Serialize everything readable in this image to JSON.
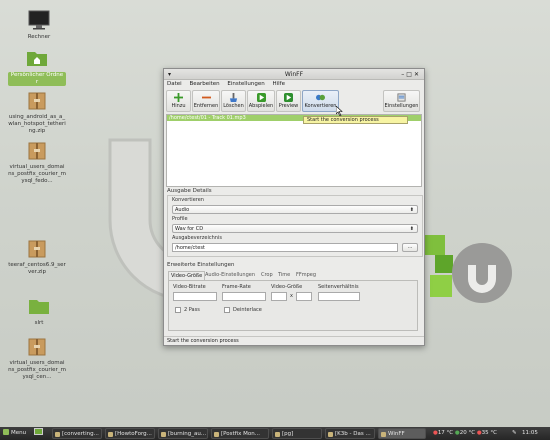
{
  "desktop": {
    "icons": [
      {
        "name": "computer",
        "label": "Rechner",
        "selected": false
      },
      {
        "name": "home-folder",
        "label": "Persönlicher Ordner",
        "selected": true
      },
      {
        "name": "archive-1",
        "label": "using_android_as_a_wlan_hotspot_tethering.zip",
        "selected": false
      },
      {
        "name": "archive-2",
        "label": "virtual_users_domains_postfix_courier_mysql_fedo...",
        "selected": false
      },
      {
        "name": "archive-3",
        "label": "teeraf_centos6.9_server.zip",
        "selected": false
      },
      {
        "name": "folder-slirt",
        "label": "slrt",
        "selected": false
      },
      {
        "name": "archive-4",
        "label": "virtual_users_domains_postfix_courier_mysql_cen...",
        "selected": false
      }
    ]
  },
  "window": {
    "title": "WinFF",
    "menu": [
      "Datei",
      "Bearbeiten",
      "Einstellungen",
      "Hilfe"
    ],
    "toolbar": [
      {
        "label": "Hinzu",
        "icon": "plus-icon"
      },
      {
        "label": "Entfernen",
        "icon": "minus-icon"
      },
      {
        "label": "Löschen",
        "icon": "broom-icon"
      },
      {
        "label": "Abspielen",
        "icon": "play-icon"
      },
      {
        "label": "Preview",
        "icon": "preview-icon"
      },
      {
        "label": "Konvertieren",
        "icon": "convert-icon"
      },
      {
        "label": "Einstellungen",
        "icon": "settings-icon"
      }
    ],
    "file_row": "/home/ctest/01 - Track 01.mp3",
    "tooltip": "Start the conversion process",
    "output_details": {
      "section_label": "Ausgabe Details",
      "convert_label": "Konvertieren",
      "convert_value": "Audio",
      "profile_label": "Profile",
      "profile_value": "Wav for CD",
      "output_dir_label": "Ausgabeverzeichnis",
      "output_dir_value": "/home/ctest",
      "browse_label": "..."
    },
    "advanced": {
      "section_label": "Erweiterte Einstellungen",
      "tabs": [
        "Video-Größe",
        "Audio-Einstellungen",
        "Crop",
        "Time",
        "FFmpeg"
      ],
      "video_bitrate_label": "Video-Bitrate",
      "frame_rate_label": "Frame-Rate",
      "video_size_label": "Video-Größe",
      "size_separator": "x",
      "aspect_label": "Seitenverhältnis",
      "two_pass_label": "2 Pass",
      "deinterlace_label": "Deinterlace"
    },
    "status": "Start the conversion process"
  },
  "taskbar": {
    "menu_label": "Menu",
    "tasks": [
      "[converting...",
      "[HowtoForg...",
      "[burning_au...",
      "[Postfix Mon...",
      "[pg]",
      "[K3b - Das ...",
      "WinFF"
    ],
    "temps": [
      "17 °C",
      "20 °C",
      "35 °C"
    ],
    "clock": "11:05"
  },
  "colors": {
    "mint_green": "#8fbd58",
    "selection": "#9fcf6a",
    "tooltip_bg": "#f7f4a3"
  }
}
